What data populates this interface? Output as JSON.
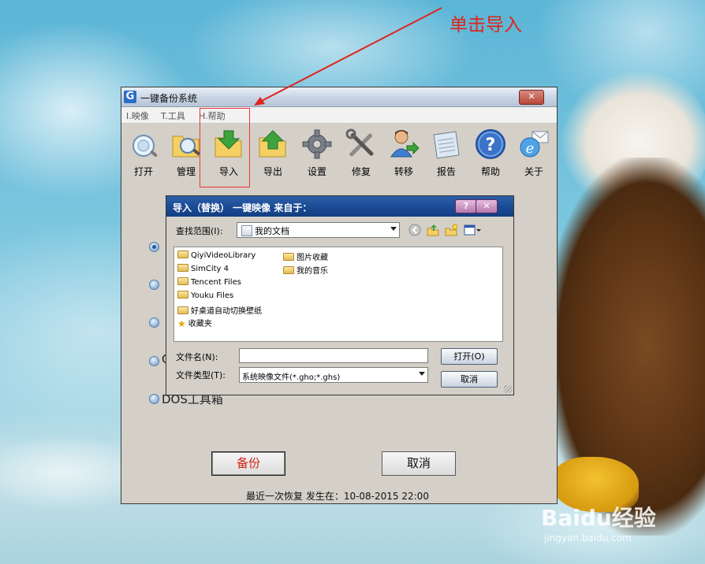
{
  "annotation": {
    "text": "单击导入"
  },
  "main_window": {
    "title": "一键备份系统",
    "app_icon_letter": "G",
    "close_glyph": "✕",
    "menu": [
      "I.映像",
      "T.工具",
      "H.帮助"
    ],
    "toolbar": [
      {
        "label": "打开",
        "icon": "open-icon"
      },
      {
        "label": "管理",
        "icon": "manage-icon"
      },
      {
        "label": "导入",
        "icon": "import-icon"
      },
      {
        "label": "导出",
        "icon": "export-icon"
      },
      {
        "label": "设置",
        "icon": "settings-gear-icon"
      },
      {
        "label": "修复",
        "icon": "repair-tools-icon"
      },
      {
        "label": "转移",
        "icon": "transfer-user-icon"
      },
      {
        "label": "报告",
        "icon": "report-notepad-icon"
      },
      {
        "label": "帮助",
        "icon": "help-icon"
      },
      {
        "label": "关于",
        "icon": "about-ie-icon"
      }
    ],
    "options": [
      {
        "label": "",
        "checked": true
      },
      {
        "label": "",
        "checked": false
      },
      {
        "label": "",
        "checked": false
      },
      {
        "label": "C",
        "checked": false
      },
      {
        "label": "DOS工具箱",
        "checked": false
      }
    ],
    "backup_button": "备份",
    "cancel_button": "取消",
    "status": "最近一次恢复 发生在：10-08-2015  22:00"
  },
  "dialog": {
    "title": "导入（替换） 一键映像 来自于：",
    "help_glyph": "?",
    "close_glyph": "✕",
    "look_in_label": "查找范围(I):",
    "look_in_value": "我的文档",
    "files_col1": [
      {
        "name": "QiyiVideoLibrary",
        "type": "folder"
      },
      {
        "name": "SimCity 4",
        "type": "folder"
      },
      {
        "name": "Tencent Files",
        "type": "folder"
      },
      {
        "name": "Youku Files",
        "type": "folder"
      },
      {
        "name": "好桌道自动切换壁纸",
        "type": "folder"
      },
      {
        "name": "收藏夹",
        "type": "favorites"
      }
    ],
    "files_col2": [
      {
        "name": "图片收藏",
        "type": "special-folder"
      },
      {
        "name": "我的音乐",
        "type": "special-folder"
      }
    ],
    "file_name_label": "文件名(N):",
    "file_name_value": "",
    "file_type_label": "文件类型(T):",
    "file_type_value": "系统映像文件(*.gho;*.ghs)",
    "open_button": "打开(O)",
    "cancel_button": "取消"
  },
  "watermark": {
    "text": "Baidu经验",
    "url_text": "jingyan.baidu.com"
  }
}
